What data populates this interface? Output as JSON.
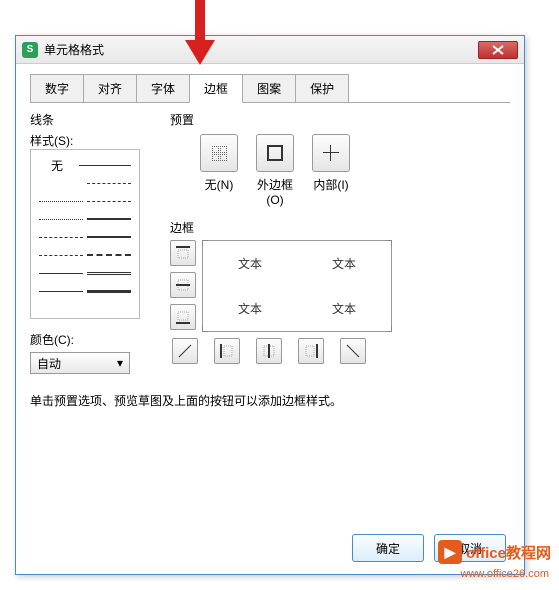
{
  "window": {
    "title": "单元格格式",
    "icon_letter": "S"
  },
  "tabs": [
    "数字",
    "对齐",
    "字体",
    "边框",
    "图案",
    "保护"
  ],
  "active_tab_index": 3,
  "line": {
    "group_label": "线条",
    "style_label": "样式(S):",
    "none_label": "无"
  },
  "color": {
    "label": "颜色(C):",
    "value": "自动"
  },
  "preset": {
    "group_label": "预置",
    "items": [
      "无(N)",
      "外边框(O)",
      "内部(I)"
    ]
  },
  "border": {
    "group_label": "边框",
    "sample_text": "文本"
  },
  "hint": "单击预置选项、预览草图及上面的按钮可以添加边框样式。",
  "buttons": {
    "ok": "确定",
    "cancel": "取消"
  },
  "watermark": {
    "brand": "office教程网",
    "url": "www.office26.com"
  }
}
